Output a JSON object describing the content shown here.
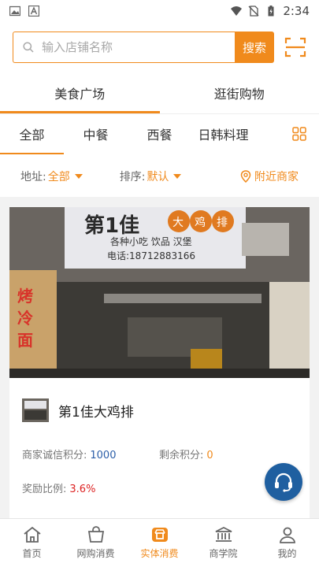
{
  "status_bar": {
    "time": "2:34"
  },
  "search": {
    "placeholder": "输入店铺名称",
    "button_label": "搜索"
  },
  "category_tabs": [
    {
      "label": "美食广场",
      "active": true
    },
    {
      "label": "逛街购物",
      "active": false
    }
  ],
  "sub_tabs": [
    {
      "label": "全部",
      "active": true
    },
    {
      "label": "中餐",
      "active": false
    },
    {
      "label": "西餐",
      "active": false
    },
    {
      "label": "日韩料理",
      "active": false
    }
  ],
  "filters": {
    "address_label": "地址:",
    "address_value": "全部",
    "sort_label": "排序:",
    "sort_value": "默认",
    "nearby_label": "附近商家"
  },
  "merchant": {
    "name": "第1佳大鸡排",
    "integrity_label": "商家诚信积分:",
    "integrity_value": "1000",
    "remaining_label": "剩余积分:",
    "remaining_value": "0",
    "reward_label": "奖励比例:",
    "reward_value": "3.6%"
  },
  "bottom_nav": [
    {
      "label": "首页",
      "icon": "home-icon",
      "active": false
    },
    {
      "label": "网购消费",
      "icon": "shopping-bag-icon",
      "active": false
    },
    {
      "label": "实体消费",
      "icon": "store-icon",
      "active": true
    },
    {
      "label": "商学院",
      "icon": "institution-icon",
      "active": false
    },
    {
      "label": "我的",
      "icon": "user-icon",
      "active": false
    }
  ],
  "colors": {
    "accent": "#f08a1c",
    "link_blue": "#2b5ea8",
    "support_blue": "#1f5fa0",
    "reward_red": "#dd2222"
  }
}
